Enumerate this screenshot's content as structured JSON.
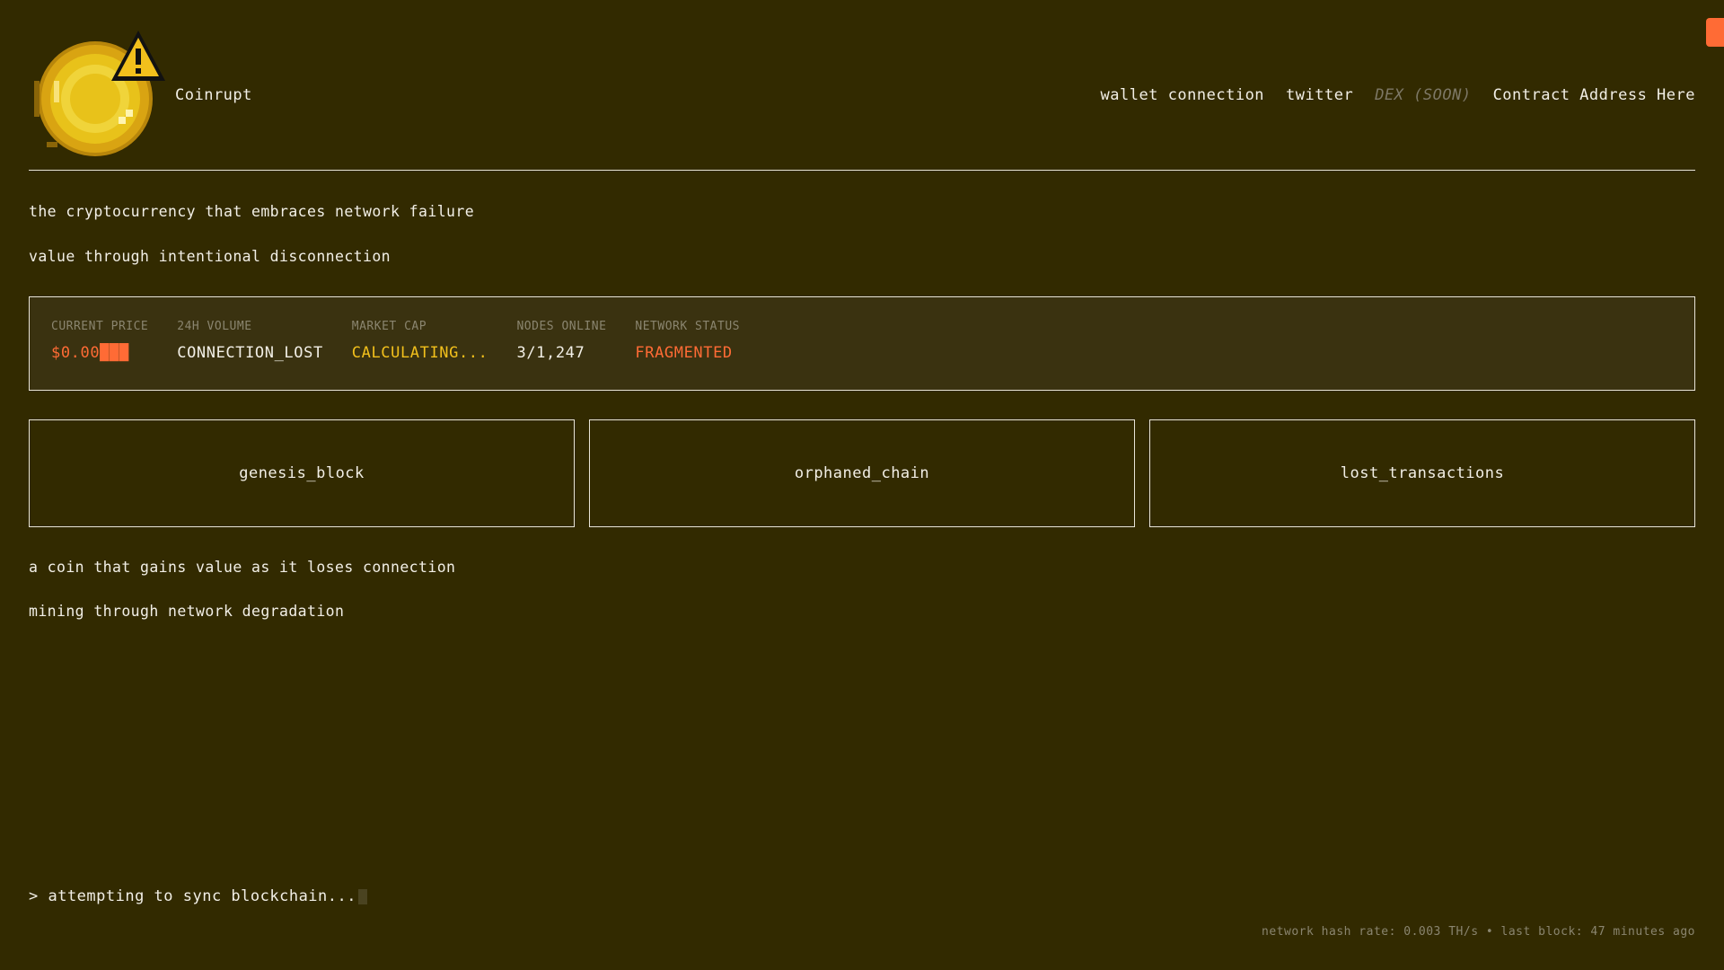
{
  "header": {
    "brand": "Coinrupt",
    "nav": {
      "wallet": "wallet connection",
      "twitter": "twitter",
      "dex": "DEX (SOON)",
      "contract": "Contract Address Here"
    }
  },
  "taglines": {
    "line1": "the cryptocurrency that embraces network failure",
    "line2": "value through intentional disconnection",
    "line3": "a coin that gains value as it loses connection",
    "line4": "mining through network degradation"
  },
  "stats": [
    {
      "label": "CURRENT PRICE",
      "value": "$0.00███"
    },
    {
      "label": "24H VOLUME",
      "value": "CONNECTION_LOST"
    },
    {
      "label": "MARKET CAP",
      "value": "CALCULATING..."
    },
    {
      "label": "NODES ONLINE",
      "value": "3/1,247"
    },
    {
      "label": "NETWORK STATUS",
      "value": "FRAGMENTED"
    }
  ],
  "cards": [
    "genesis_block",
    "orphaned_chain",
    "lost_transactions"
  ],
  "terminal": "> attempting to sync blockchain...",
  "footer": "network hash rate: 0.003 TH/s • last block: 47 minutes ago",
  "colors": {
    "background": "#322a00",
    "accent_orange": "#ff6b35",
    "accent_yellow": "#f2c01c",
    "muted": "#8a856f"
  },
  "icons": {
    "logo": "pixel-coin-with-warning-icon"
  }
}
